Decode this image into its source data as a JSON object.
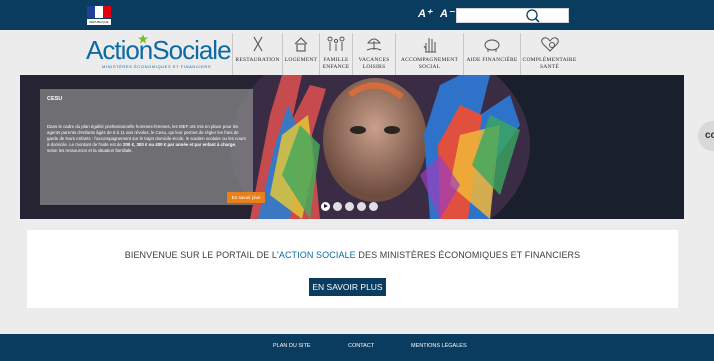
{
  "topbar": {
    "flag_caption": "RÉPUBLIQUE FRANÇAISE",
    "font_increase": "A⁺",
    "font_decrease": "A⁻",
    "search": {
      "value": "",
      "placeholder": ""
    }
  },
  "logo": {
    "main": "ActionSociale",
    "part1": "Action",
    "part2": "Sociale",
    "subtitle": "MINISTÈRES ÉCONOMIQUES ET FINANCIERS"
  },
  "nav": [
    {
      "label": "RESTAURATION",
      "icon": "cutlery-icon"
    },
    {
      "label": "LOGEMENT",
      "icon": "house-icon"
    },
    {
      "label": "FAMILLE ENFANCE",
      "icon": "family-icon"
    },
    {
      "label": "VACANCES LOISIRS",
      "icon": "beach-icon"
    },
    {
      "label": "ACCOMPAGNEMENT SOCIAL",
      "icon": "hand-icon"
    },
    {
      "label": "AIDE FINANCIÈRE",
      "icon": "piggy-bank-icon"
    },
    {
      "label": "COMPLÉMENTAIRE SANTÉ",
      "icon": "heart-health-icon"
    }
  ],
  "hero": {
    "title": "CESU",
    "text_part1": "Dans le cadre du plan égalité professionnelle hommes-femmes, les MEF ont mis en place pour les agents parents d'enfants âgés de 6 à 11 ans révolus, le Cesu, qui leur permet de régler les frais de garde de leurs enfants : l'accompagnement sur le trajet domicile-école, le soutien scolaire ou les cours à domicile. Le montant de l'aide est de",
    "text_bold": "200 €, 300 € ou 400 € par année et par enfant à charge",
    "text_part2": ", selon les ressources et la situation familiale.",
    "button": "En savoir plus",
    "slides": 5,
    "active_slide": 1,
    "side_tab": "co"
  },
  "welcome": {
    "text_before": "BIENVENUE SUR LE PORTAIL DE L'",
    "text_highlight": "ACTION SOCIALE",
    "text_after": " DES MINISTÈRES ÉCONOMIQUES ET FINANCIERS",
    "button": "EN SAVOIR PLUS"
  },
  "footer": {
    "links": [
      "PLAN DU SITE",
      "CONTACT",
      "MENTIONS LÉGALES"
    ]
  },
  "colors": {
    "navy": "#0a3c5f",
    "brand_blue": "#0b6ba4",
    "accent_orange": "#e8801c",
    "logo_star": "#7ab929"
  }
}
